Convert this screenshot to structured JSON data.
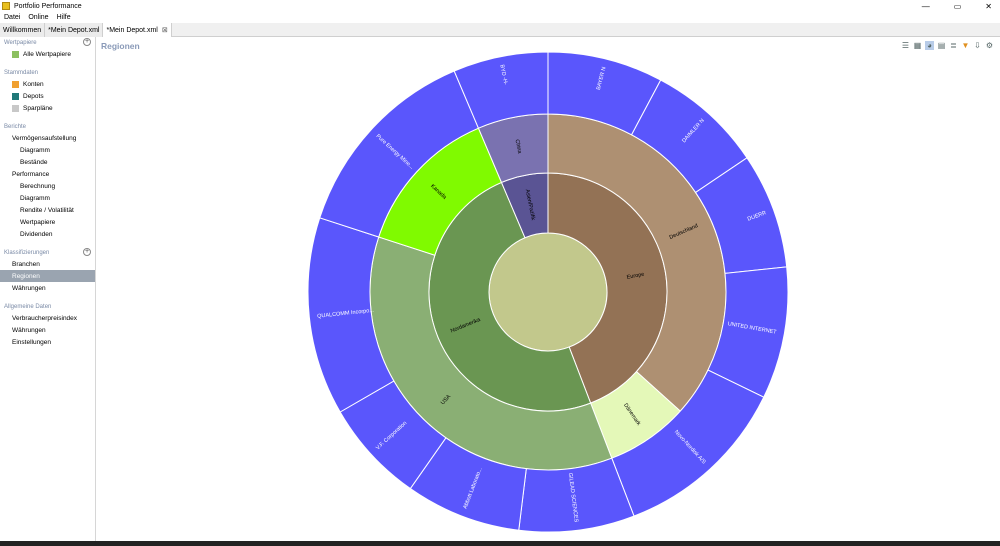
{
  "window": {
    "title": "Portfolio Performance",
    "min": "—",
    "max": "▭",
    "close": "✕"
  },
  "menu": [
    "Datei",
    "Online",
    "Hilfe"
  ],
  "tabs": [
    {
      "label": "Willkommen",
      "active": false
    },
    {
      "label": "*Mein Depot.xml",
      "active": false
    },
    {
      "label": "*Mein Depot.xml",
      "active": true
    }
  ],
  "sidebar": {
    "wertpapiere": {
      "head": "Wertpapiere",
      "items": [
        "Alle Wertpapiere"
      ]
    },
    "stammdaten": {
      "head": "Stammdaten",
      "items": [
        {
          "label": "Konten",
          "color": "#f0a030"
        },
        {
          "label": "Depots",
          "color": "#207878"
        },
        {
          "label": "Sparpläne",
          "color": "#c8c8c8"
        }
      ]
    },
    "berichte": {
      "head": "Berichte",
      "items": [
        {
          "label": "Vermögensaufstellung",
          "level": 1
        },
        {
          "label": "Diagramm",
          "level": 2
        },
        {
          "label": "Bestände",
          "level": 2
        },
        {
          "label": "Performance",
          "level": 1
        },
        {
          "label": "Berechnung",
          "level": 2
        },
        {
          "label": "Diagramm",
          "level": 2
        },
        {
          "label": "Rendite / Volatilität",
          "level": 2
        },
        {
          "label": "Wertpapiere",
          "level": 2
        },
        {
          "label": "Dividenden",
          "level": 2
        }
      ]
    },
    "klassifizierungen": {
      "head": "Klassifizierungen",
      "items": [
        "Branchen",
        "Regionen",
        "Währungen"
      ],
      "selected": "Regionen"
    },
    "allgemein": {
      "head": "Allgemeine Daten",
      "items": [
        "Verbraucherpreisindex",
        "Währungen",
        "Einstellungen"
      ]
    }
  },
  "main": {
    "title": "Regionen"
  },
  "toolbar": [
    "list-icon",
    "treemap-icon",
    "donut-icon",
    "grid-icon",
    "stack-icon",
    "filter-icon",
    "export-icon",
    "settings-icon"
  ],
  "chart_data": {
    "type": "sunburst",
    "center_color": "#c2c88c",
    "rings": [
      {
        "name": "continent",
        "segments": [
          {
            "label": "Europe",
            "start": 0,
            "end": 159,
            "color": "#937255"
          },
          {
            "label": "Nordamerika",
            "start": 159,
            "end": 337,
            "color": "#6a9652"
          },
          {
            "label": "Asien/Pazifik",
            "start": 337,
            "end": 360,
            "color": "#5a5494"
          }
        ]
      },
      {
        "name": "country",
        "segments": [
          {
            "label": "Deutschland",
            "start": 0,
            "end": 132,
            "color": "#ae9072"
          },
          {
            "label": "Dänemark",
            "start": 132,
            "end": 159,
            "color": "#e4f8b8"
          },
          {
            "label": "USA",
            "start": 159,
            "end": 288,
            "color": "#8aaf74"
          },
          {
            "label": "Kanada",
            "start": 288,
            "end": 337,
            "color": "#80fa00"
          },
          {
            "label": "China",
            "start": 337,
            "end": 360,
            "color": "#7a72b0"
          }
        ]
      },
      {
        "name": "security",
        "color": "#5a56fc",
        "segments": [
          {
            "label": "BAYER N",
            "start": 0,
            "end": 28
          },
          {
            "label": "DAIMLER N",
            "start": 28,
            "end": 56
          },
          {
            "label": "DUERR",
            "start": 56,
            "end": 84
          },
          {
            "label": "UNITED INTERNET",
            "start": 84,
            "end": 116
          },
          {
            "label": "Novo-Nordisk A/S",
            "start": 116,
            "end": 159
          },
          {
            "label": "GILEAD SCIENCES",
            "start": 159,
            "end": 187
          },
          {
            "label": "Abbott Laborato...",
            "start": 187,
            "end": 215
          },
          {
            "label": "V.F. Corporation",
            "start": 215,
            "end": 240
          },
          {
            "label": "QUALCOMM Incorpo...",
            "start": 240,
            "end": 288
          },
          {
            "label": "Pure Energy Mine...",
            "start": 288,
            "end": 337
          },
          {
            "label": "BYD -H-",
            "start": 337,
            "end": 360
          }
        ]
      }
    ]
  }
}
